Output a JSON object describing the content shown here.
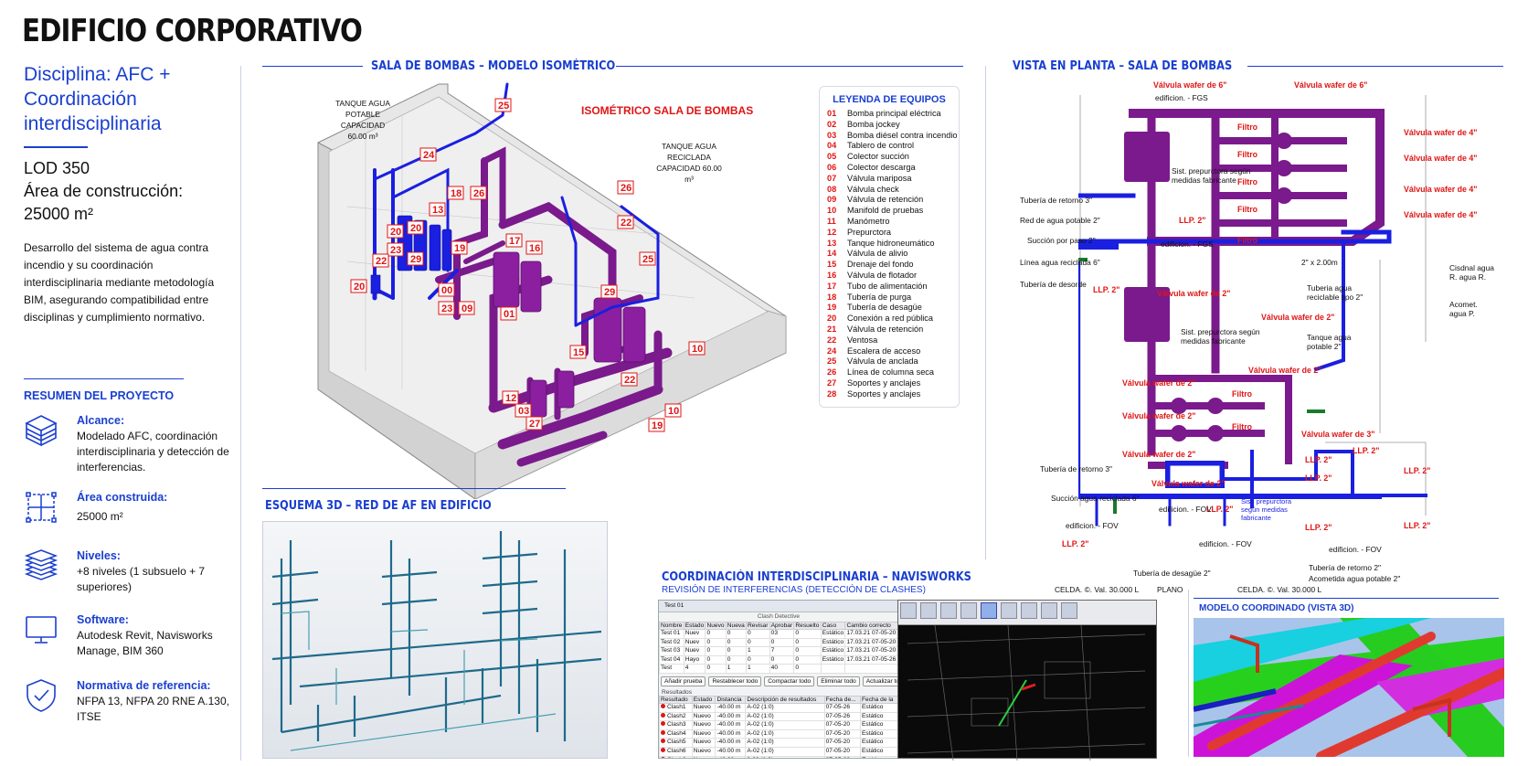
{
  "title": "EDIFICIO CORPORATIVO",
  "discipline": "Disciplina: AFC + Coordinación interdisciplinaria",
  "lod": "LOD 350",
  "area_label": "Área de construcción:",
  "area_value": "25000 m²",
  "description": "Desarrollo del sistema de agua contra incendio y su coordinación interdisciplinaria mediante metodología BIM, asegurando compatibilidad entre disciplinas y cumplimiento normativo.",
  "summary": {
    "title": "RESUMEN DEL PROYECTO",
    "items": [
      {
        "icon": "cube-icon",
        "heading": "Alcance:",
        "text": "Modelado AFC, coordinación interdisciplinaria y detección de interferencias."
      },
      {
        "icon": "grid-area-icon",
        "heading": "Área construida:",
        "text": "25000 m²"
      },
      {
        "icon": "layers-icon",
        "heading": "Niveles:",
        "text": "+8 niveles (1 subsuelo + 7 superiores)"
      },
      {
        "icon": "monitor-icon",
        "heading": "Software:",
        "text": "Autodesk Revit, Navisworks Manage, BIM 360"
      },
      {
        "icon": "shield-check-icon",
        "heading": "Normativa de referencia:",
        "text": "NFPA 13, NFPA 20 RNE A.130, ITSE"
      }
    ]
  },
  "iso": {
    "section_title": "SALA DE BOMBAS – MODELO ISOMÉTRICO",
    "drawing_title": "ISOMÉTRICO SALA DE BOMBAS",
    "tank1": "TANQUE AGUA POTABLE CAPACIDAD 60.00 m³",
    "tank2": "TANQUE AGUA RECICLADA CAPACIDAD 60.00 m³",
    "tags": [
      "25",
      "24",
      "18",
      "13",
      "26",
      "26",
      "22",
      "20",
      "20",
      "23",
      "22",
      "29",
      "19",
      "17",
      "16",
      "25",
      "20",
      "00",
      "23",
      "09",
      "01",
      "29",
      "15",
      "10",
      "12",
      "03",
      "27",
      "22",
      "10",
      "19"
    ]
  },
  "legend": {
    "title": "LEYENDA DE EQUIPOS",
    "rows": [
      {
        "n": "01",
        "t": "Bomba principal eléctrica"
      },
      {
        "n": "02",
        "t": "Bomba jockey"
      },
      {
        "n": "03",
        "t": "Bomba diésel contra incendio"
      },
      {
        "n": "04",
        "t": "Tablero de control"
      },
      {
        "n": "05",
        "t": "Colector succión"
      },
      {
        "n": "06",
        "t": "Colector descarga"
      },
      {
        "n": "07",
        "t": "Válvula mariposa"
      },
      {
        "n": "08",
        "t": "Válvula check"
      },
      {
        "n": "09",
        "t": "Válvula de retención"
      },
      {
        "n": "10",
        "t": "Manifold de pruebas"
      },
      {
        "n": "11",
        "t": "Manómetro"
      },
      {
        "n": "12",
        "t": "Prepurctora"
      },
      {
        "n": "13",
        "t": "Tanque hidroneumático"
      },
      {
        "n": "14",
        "t": "Válvula de alivio"
      },
      {
        "n": "15",
        "t": "Drenaje del fondo"
      },
      {
        "n": "16",
        "t": "Válvula de flotador"
      },
      {
        "n": "17",
        "t": "Tubo de alimentación"
      },
      {
        "n": "18",
        "t": "Tubería de purga"
      },
      {
        "n": "19",
        "t": "Tubería de desagüe"
      },
      {
        "n": "20",
        "t": "Conexión a red pública"
      },
      {
        "n": "21",
        "t": "Válvula de retención"
      },
      {
        "n": "22",
        "t": "Ventosa"
      },
      {
        "n": "24",
        "t": "Escalera de acceso"
      },
      {
        "n": "25",
        "t": "Válvula de anclada"
      },
      {
        "n": "26",
        "t": "Línea de columna seca"
      },
      {
        "n": "27",
        "t": "Soportes y anclajes"
      },
      {
        "n": "28",
        "t": "Soportes y anclajes"
      }
    ]
  },
  "plan": {
    "section_title": "VISTA EN PLANTA – SALA DE BOMBAS",
    "red_labels": [
      "Válvula wafer de 6\"",
      "Válvula wafer de 6\"",
      "Válvula wafer de 4\"",
      "Válvula wafer de 4\"",
      "Válvula wafer de 4\"",
      "Válvula wafer de 4\"",
      "Filtro",
      "Filtro",
      "Filtro",
      "Filtro",
      "Filtro",
      "LLP. 2\"",
      "LLP. 2\"",
      "Válvula wafer de 2\"",
      "Válvula wafer de 2\"",
      "Válvula wafer de 2\"",
      "Válvula wafer de 2\"",
      "Válvula wafer de 2\"",
      "Válvula wafer de 2\"",
      "Válvula wafer de 2\"",
      "Válvula wafer de 3\"",
      "Filtro",
      "Filtro",
      "LLP. 2\"",
      "LLP. 2\"",
      "LLP. 2\"",
      "LLP. 2\"",
      "LLP. 2\"",
      "LLP. 2\"",
      "LLP. 2\"",
      "LLP. 2\""
    ],
    "black_labels": [
      "edificion. - FGS",
      "Tubería de retorno 3\"",
      "Red de agua potable 2\"",
      "Succión por paso 2\"",
      "edificion. - FGS",
      "Línea agua reciclada 6\"",
      "Tubería de desorde",
      "Sist. prepurctora según medidas fabricante",
      "Sist. prepurctora según medidas fabricante",
      "Tubería de retorno 3\"",
      "Succión agua reciclada 6\"",
      "edificion. - FOV",
      "edificion. - FOV",
      "edificion. - FOV",
      "edificion. - FOV",
      "Tubería de desagüe 2\"",
      "Tubería de retorno 2\"",
      "Acometida agua potable 2\"",
      "CELDA. ©. Val. 30.000 L",
      "PLANO",
      "CELDA. ©. Val. 30.000 L",
      "2\" x 2.00m",
      "Tuberia agua reciclable tipo 2\"",
      "Tanque agua potable 2\"",
      "Cisdnal agua R. agua R.",
      "Acomet. agua P.",
      "Sist. prepurctora según medidas fabricante"
    ]
  },
  "scheme": {
    "section_title": "ESQUEMA 3D – RED DE AF EN EDIFICIO"
  },
  "navis": {
    "section_title": "COORDINACIÓN INTERDISCIPLINARIA – NAVISWORKS",
    "subtitle": "REVISIÓN DE INTERFERENCIAS (DETECCIÓN DE CLASHES)",
    "test_name": "Test 01",
    "panel_title": "Clash Detective",
    "headers1": [
      "Nombre",
      "Estado",
      "Nuevo",
      "Nueva",
      "Revisar",
      "Aprobar",
      "Resuelto",
      "Caso",
      "Cambio correcto"
    ],
    "rows1": [
      [
        "Test 01",
        "Nuev",
        "0",
        "0",
        "0",
        "03",
        "0",
        "Estático",
        "17.03.21 07-05-20"
      ],
      [
        "Test 02",
        "Nuev",
        "0",
        "0",
        "0",
        "0",
        "0",
        "Estático",
        "17.03.21 07-05-20"
      ],
      [
        "Test 03",
        "Nuev",
        "0",
        "0",
        "1",
        "7",
        "0",
        "Estático",
        "17.03.21 07-05-20"
      ],
      [
        "Test 04",
        "Hayo",
        "0",
        "0",
        "0",
        "0",
        "0",
        "Estático",
        "17.03.21 07-05-26"
      ],
      [
        "Test",
        "4",
        "0",
        "1",
        "1",
        "40",
        "0",
        "",
        " "
      ]
    ],
    "buttons": [
      "Añadir prueba",
      "Restablecer todo",
      "Compactar todo",
      "Eliminar todo",
      "Actualizar todo"
    ],
    "results_label": "Resultados",
    "headers2": [
      "Resultado",
      "Estado",
      "Distancia",
      "Descripción de resultados",
      "Fecha de...",
      "Fecha de la"
    ],
    "rows2": [
      [
        "Clash1",
        "Nuevo",
        "-40.00 m",
        "A-02 (1:0)",
        "07-05-26",
        "Estático"
      ],
      [
        "Clash2",
        "Nuevo",
        "-40.00 m",
        "A-02 (1:0)",
        "07-05-26",
        "Estático"
      ],
      [
        "Clash3",
        "Nuevo",
        "-40.00 m",
        "A-02 (1:0)",
        "07-05-20",
        "Estático"
      ],
      [
        "Clash4",
        "Nuevo",
        "-40.00 m",
        "A-02 (1:0)",
        "07-05-20",
        "Estático"
      ],
      [
        "Clash5",
        "Nuevo",
        "-40.00 m",
        "A-02 (1:0)",
        "07-05-20",
        "Estático"
      ],
      [
        "Clash6",
        "Nuevo",
        "-40.00 m",
        "A-02 (1:0)",
        "07-05-20",
        "Estático"
      ],
      [
        "Clash6",
        "Nuevo",
        "-40.00 m",
        "0-02 (1:0)",
        "07-05-20",
        "Estático"
      ]
    ]
  },
  "coord": {
    "section_title": "MODELO COORDINADO (VISTA 3D)"
  },
  "colors": {
    "accent": "#1a3fd0",
    "pipe_purple": "#7a1a8c",
    "pipe_blue": "#1a1fe0",
    "tag_red": "#e01515"
  }
}
